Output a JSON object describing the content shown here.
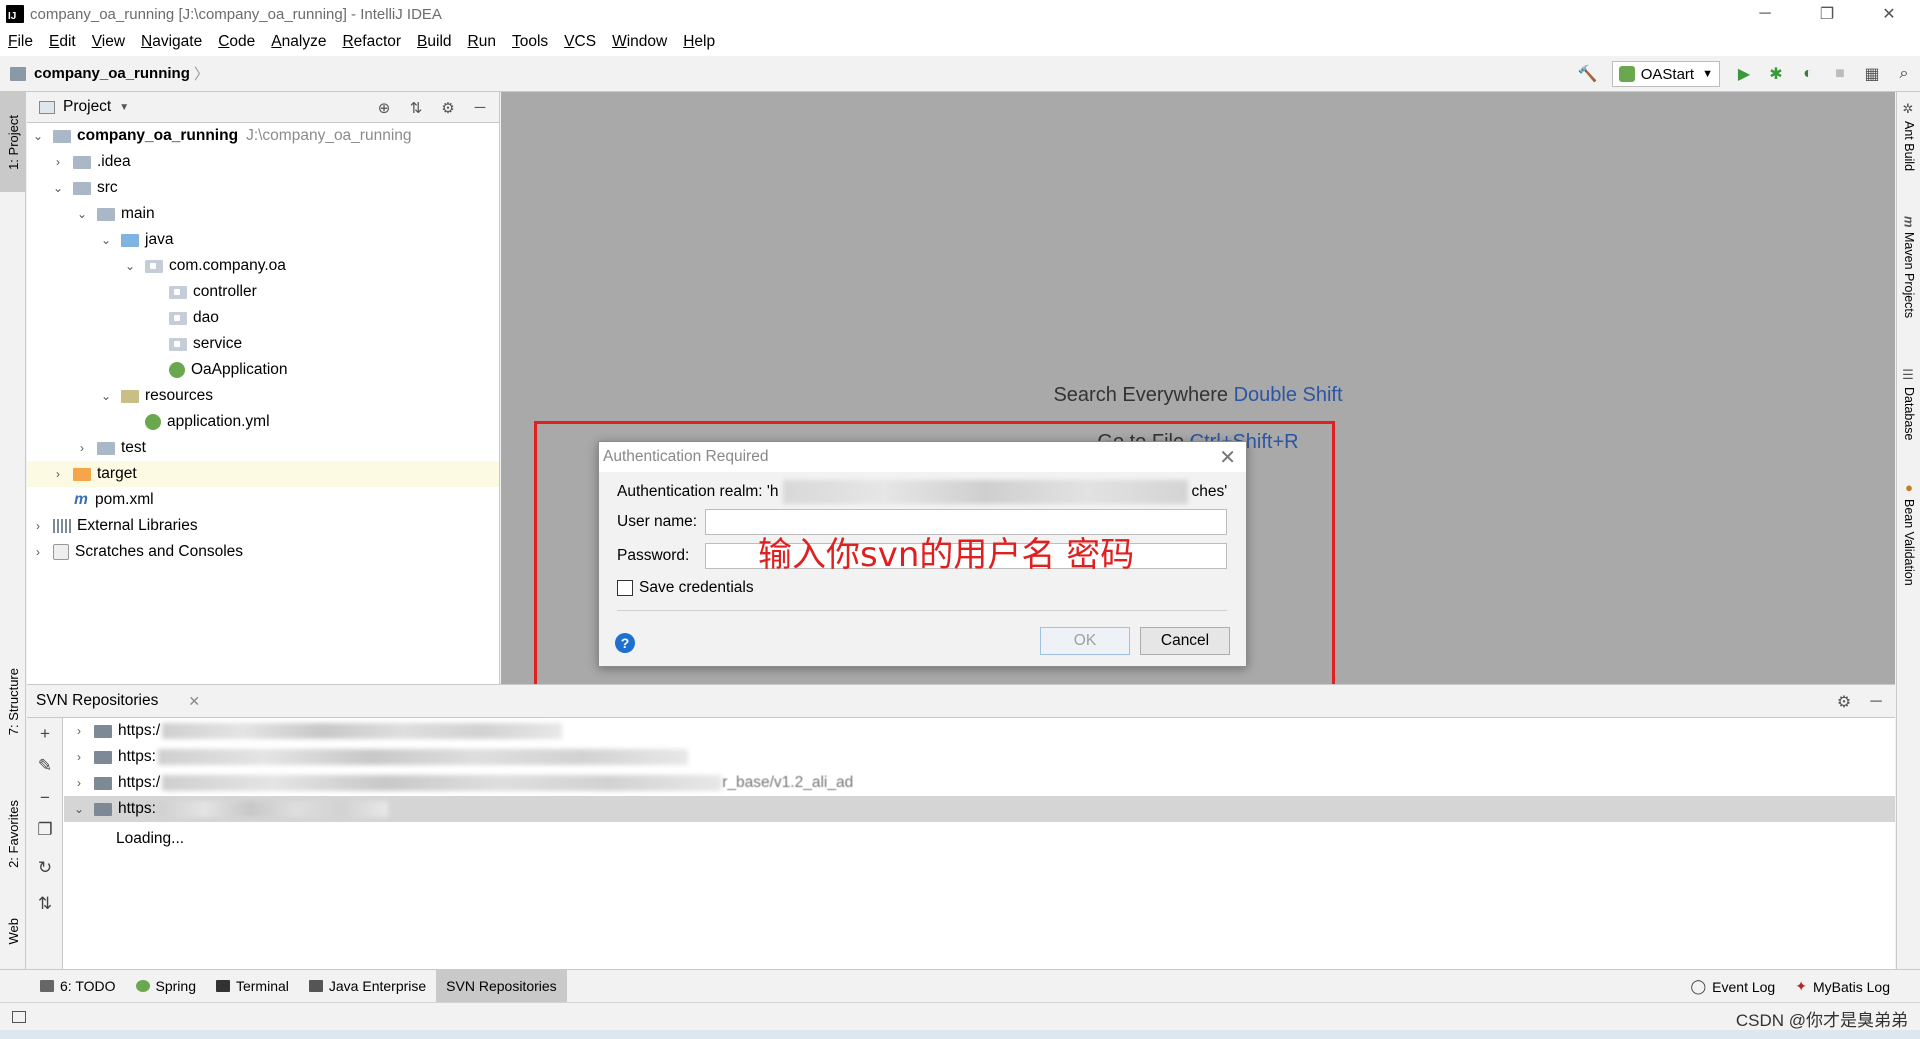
{
  "window": {
    "title": "company_oa_running [J:\\company_oa_running] - IntelliJ IDEA",
    "app_icon_text": "IJ",
    "controls": [
      "─",
      "❐",
      "✕"
    ]
  },
  "menu": [
    "File",
    "Edit",
    "View",
    "Navigate",
    "Code",
    "Analyze",
    "Refactor",
    "Build",
    "Run",
    "Tools",
    "VCS",
    "Window",
    "Help"
  ],
  "breadcrumb": "company_oa_running",
  "run_config": "OAStart",
  "left_tabs": {
    "project": "1: Project",
    "structure": "7: Structure",
    "favorites": "2: Favorites",
    "web": "Web"
  },
  "right_tabs": {
    "ant": "Ant Build",
    "maven": "Maven Projects",
    "database": "Database",
    "bean": "Bean Validation"
  },
  "project_panel": {
    "title": "Project",
    "root_name": "company_oa_running",
    "root_path": "J:\\company_oa_running",
    "items": {
      "idea": ".idea",
      "src": "src",
      "main": "main",
      "java": "java",
      "pkg": "com.company.oa",
      "controller": "controller",
      "dao": "dao",
      "service": "service",
      "oa_app": "OaApplication",
      "resources": "resources",
      "app_yml": "application.yml",
      "test": "test",
      "target": "target",
      "pom": "pom.xml",
      "ext_libs": "External Libraries",
      "scratches": "Scratches and Consoles"
    }
  },
  "editor": {
    "hint1_text": "Search Everywhere",
    "hint1_shortcut": "Double Shift",
    "hint2_text": "Go to File",
    "hint2_shortcut": "Ctrl+Shift+R"
  },
  "dialog": {
    "title": "Authentication Required",
    "realm_label": "Authentication realm: 'h",
    "realm_tail": "ches'",
    "username_label": "User name:",
    "username_value": "",
    "password_label": "Password:",
    "password_value": "",
    "save_credentials": "Save credentials",
    "save_checked": false,
    "ok": "OK",
    "cancel": "Cancel",
    "help": "?"
  },
  "annotation": "输入你svn的用户名 密码",
  "svn_panel": {
    "title": "SVN Repositories",
    "repos": [
      "https:/",
      "https:",
      "https:/",
      "https:"
    ],
    "repo_tail": "r_base/v1.2_ali_ad",
    "loading": "Loading..."
  },
  "bottom_tools": {
    "todo": "6: TODO",
    "spring": "Spring",
    "terminal": "Terminal",
    "java_ee": "Java Enterprise",
    "svn": "SVN Repositories",
    "event_log": "Event Log",
    "mybatis_log": "MyBatis Log"
  },
  "watermark": "CSDN @你才是臭弟弟"
}
